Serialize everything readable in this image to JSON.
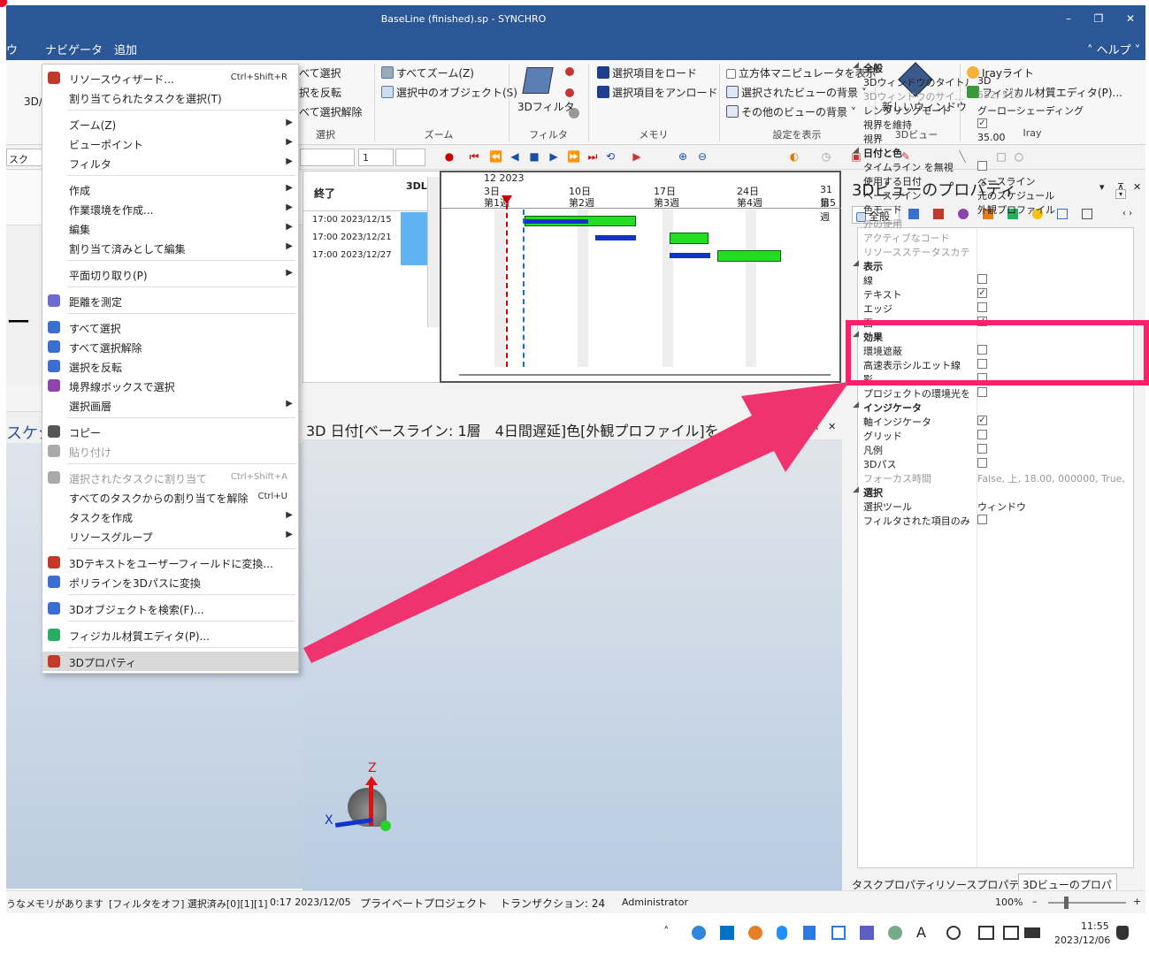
{
  "window": {
    "title": "BaseLine (finished).sp - SYNCHRO",
    "minimize": "–",
    "restore": "❐",
    "close": "✕"
  },
  "menubar": {
    "items": [
      "ウ",
      "ナビゲータ",
      "追加"
    ],
    "help": "˄ ヘルプ ˅"
  },
  "ribbon": {
    "left_label": "3D/",
    "select_items": [
      "べて選択",
      "択を反転",
      "べて選択解除"
    ],
    "select_group": "選択",
    "zoom_items": [
      "すべてズーム(Z)",
      "選択中のオブジェクト(S)"
    ],
    "zoom_group": "ズーム",
    "filter_label": "3Dフィルタ",
    "filter_group": "フィルタ",
    "memory_items": [
      "選択項目をロード",
      "選択項目をアンロード"
    ],
    "memory_group": "メモリ",
    "display_items": [
      "立方体マニピュレータを表示",
      "選択されたビューの背景 ˅",
      "その他のビューの背景 ˅"
    ],
    "display_group": "設定を表示",
    "new_window": "新しいウィンドウ",
    "view3d_group": "3Dビュー",
    "iray_items": [
      "Irayライト",
      "フィジカル材質エディタ(P)..."
    ],
    "iray_group": "Iray"
  },
  "toolbar2": {
    "left_text": "スク",
    "num_value": "1"
  },
  "gantt_table": {
    "header_end": "終了",
    "header_3d": "3DL",
    "rows": [
      "17:00 2023/12/15",
      "17:00 2023/12/21",
      "17:00 2023/12/27"
    ]
  },
  "gantt_chart": {
    "month": "12 2023",
    "days": [
      "3日",
      "10日",
      "17日",
      "24日",
      "31日"
    ],
    "weeks": [
      "第1週",
      "第2週",
      "第3週",
      "第4週",
      "第5週"
    ]
  },
  "left_panel": {
    "label": "スケジ",
    "glyph": "ー"
  },
  "view3d": {
    "title": "3D 日付[ベースライン: 1層　4日間遅延]色[外観プロファイル]を...",
    "axis_z": "Z",
    "axis_x": "X",
    "pin": "⊼",
    "close": "✕",
    "dropdown": "▾"
  },
  "context_menu": [
    {
      "label": "リソースウィザード...",
      "shortcut": "Ctrl+Shift+R",
      "icon": "wand-icon",
      "color": "#c0392b"
    },
    {
      "label": "割り当てられたタスクを選択(T)"
    },
    {
      "sep": true
    },
    {
      "label": "ズーム(Z)",
      "sub": true
    },
    {
      "label": "ビューポイント",
      "sub": true
    },
    {
      "label": "フィルタ",
      "sub": true
    },
    {
      "sep": true
    },
    {
      "label": "作成",
      "sub": true
    },
    {
      "label": "作業環境を作成...",
      "sub": true
    },
    {
      "label": "編集",
      "sub": true
    },
    {
      "label": "割り当て済みとして編集",
      "sub": true
    },
    {
      "sep": true
    },
    {
      "label": "平面切り取り(P)",
      "sub": true
    },
    {
      "sep": true
    },
    {
      "label": "距離を測定",
      "icon": "ruler-icon",
      "color": "#6b6bd0"
    },
    {
      "sep": true
    },
    {
      "label": "すべて選択",
      "icon": "select-all-icon",
      "color": "#3a6fd0"
    },
    {
      "label": "すべて選択解除",
      "icon": "deselect-all-icon",
      "color": "#3a6fd0"
    },
    {
      "label": "選択を反転",
      "icon": "invert-select-icon",
      "color": "#3a6fd0"
    },
    {
      "label": "境界線ボックスで選択",
      "icon": "box-select-icon",
      "color": "#8e44ad"
    },
    {
      "label": "選択画層",
      "sub": true
    },
    {
      "sep": true
    },
    {
      "label": "コピー",
      "icon": "copy-icon",
      "color": "#555555"
    },
    {
      "label": "貼り付け",
      "icon": "paste-icon",
      "color": "#aaaaaa",
      "disabled": true
    },
    {
      "sep": true
    },
    {
      "label": "選択されたタスクに割り当て",
      "shortcut": "Ctrl+Shift+A",
      "icon": "assign-icon",
      "color": "#aaaaaa",
      "disabled": true
    },
    {
      "label": "すべてのタスクからの割り当てを解除",
      "shortcut": "Ctrl+U"
    },
    {
      "label": "タスクを作成",
      "sub": true
    },
    {
      "label": "リソースグループ",
      "sub": true
    },
    {
      "sep": true
    },
    {
      "label": "3Dテキストをユーザーフィールドに変換...",
      "icon": "text3d-icon",
      "color": "#c0392b"
    },
    {
      "label": "ポリラインを3Dパスに変換",
      "icon": "polyline-icon",
      "color": "#3a6fd0"
    },
    {
      "sep": true
    },
    {
      "label": "3Dオブジェクトを検索(F)...",
      "icon": "search-3d-icon",
      "color": "#3a6fd0"
    },
    {
      "sep": true
    },
    {
      "label": "フィジカル材質エディタ(P)...",
      "icon": "material-icon",
      "color": "#27ae60"
    },
    {
      "sep": true
    },
    {
      "label": "3Dプロパティ",
      "icon": "properties-3d-icon",
      "color": "#c0392b",
      "highlighted": true
    }
  ],
  "props": {
    "title": "3Dビューのプロパティ",
    "tab_all": "全般",
    "rows": [
      {
        "type": "sec",
        "k": "全般"
      },
      {
        "k": "3Dウィンドウのタイトル",
        "v": "3D"
      },
      {
        "k": "3Dウィンドウのサイ...",
        "v": "552, 510",
        "dim": true
      },
      {
        "k": "レンダリングモード",
        "v": "グーローシェーディング"
      },
      {
        "k": "視界を維持",
        "cb": "✓"
      },
      {
        "k": "視界",
        "v": "35.00"
      },
      {
        "type": "sec",
        "k": "日付と色"
      },
      {
        "k": "タイムライン を無視",
        "cb": ""
      },
      {
        "k": "使用する日付",
        "v": "ベースライン"
      },
      {
        "k": "ベースライン",
        "v": "元のスケジュール",
        "dd": true
      },
      {
        "k": "色モード",
        "v": "外観プロファイル"
      },
      {
        "k": "外の使用",
        "v": "",
        "dim": true
      },
      {
        "k": "アクティブなコード",
        "v": "",
        "dim": true
      },
      {
        "k": "リソースステータスカテゴリ",
        "v": "",
        "dim": true
      },
      {
        "type": "sec",
        "k": "表示"
      },
      {
        "k": "線",
        "cb": ""
      },
      {
        "k": "テキスト",
        "cb": "✓"
      },
      {
        "k": "エッジ",
        "cb": ""
      },
      {
        "k": "面",
        "cb": "✓"
      },
      {
        "type": "sec",
        "k": "効果"
      },
      {
        "k": "環境遮蔽",
        "cb": ""
      },
      {
        "k": "高速表示シルエット線",
        "cb": ""
      },
      {
        "k": "影",
        "cb": ""
      },
      {
        "k": "プロジェクトの環境光を...",
        "cb": ""
      },
      {
        "type": "sec",
        "k": "インジケータ"
      },
      {
        "k": "軸インジケータ",
        "cb": "✓"
      },
      {
        "k": "グリッド",
        "cb": ""
      },
      {
        "k": "凡例",
        "cb": ""
      },
      {
        "k": "3Dパス",
        "cb": ""
      },
      {
        "k": "フォーカス時間",
        "v": "False, 上, 18.00, 000000, True, F...",
        "dim": true
      },
      {
        "type": "sec",
        "k": "選択"
      },
      {
        "k": "選択ツール",
        "v": "ウィンドウ"
      },
      {
        "k": "フィルタされた項目のみ...",
        "cb": ""
      }
    ],
    "bottom_tabs": [
      "タスクプロパティ",
      "リソースプロパティ",
      "3Dビューのプロパティ"
    ]
  },
  "status": {
    "items": [
      "うなメモリがあります",
      "[フィルタをオフ] 選択済み[0][1][1]",
      "0:17 2023/12/05",
      "プライベートプロジェクト",
      "トランザクション: 24",
      "Administrator"
    ],
    "zoom": "100%",
    "minus": "–",
    "plus": "+"
  },
  "taskbar": {
    "time": "11:55",
    "date": "2023/12/06",
    "ime": "A",
    "chevron": "˄"
  },
  "colors": {
    "accent": "#2b5797",
    "highlight_box": "#ff1f6b",
    "arrow": "#f0336f",
    "gantt_green": "#22dd22",
    "gantt_blue": "#1133cc"
  }
}
